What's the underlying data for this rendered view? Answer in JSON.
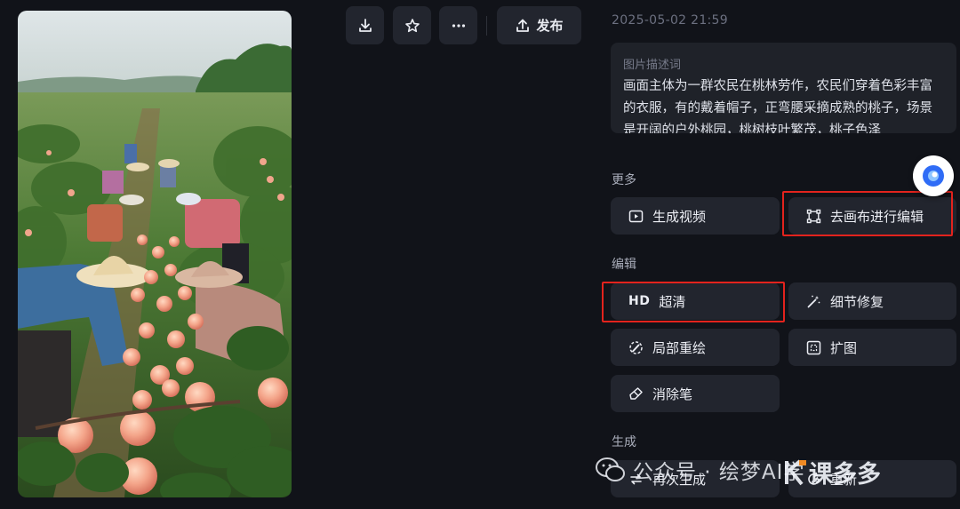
{
  "image": {
    "alt": ""
  },
  "toolbar": {
    "download_icon": "download-icon",
    "favorite_icon": "star-icon",
    "more_icon": "more-icon",
    "publish_label": "发布"
  },
  "info": {
    "timestamp": "2025-05-02 21:59",
    "prompt_label": "图片描述词",
    "prompt_text": "画面主体为一群农民在桃林劳作，农民们穿着色彩丰富的衣服，有的戴着帽子，正弯腰采摘成熟的桃子，场景是开阔的户外桃园，桃树枝叶繁茂，桃子色泽"
  },
  "sections": {
    "more": {
      "title": "更多",
      "generate_video": "生成视频",
      "canvas_edit": "去画布进行编辑"
    },
    "edit": {
      "title": "编辑",
      "hd_badge": "HD",
      "upscale": "超清",
      "detail_fix": "细节修复",
      "inpaint": "局部重绘",
      "expand": "扩图",
      "eraser": "消除笔"
    },
    "generate": {
      "title": "生成",
      "regenerate": "再次生成",
      "redraw": "重新"
    }
  },
  "watermark": {
    "text": "公众号 · 绘梦AI学",
    "logo": "课多多"
  },
  "colors": {
    "background": "#111319",
    "button": "#22252e",
    "highlight": "#e3231d",
    "accent": "#2f6cf6"
  }
}
